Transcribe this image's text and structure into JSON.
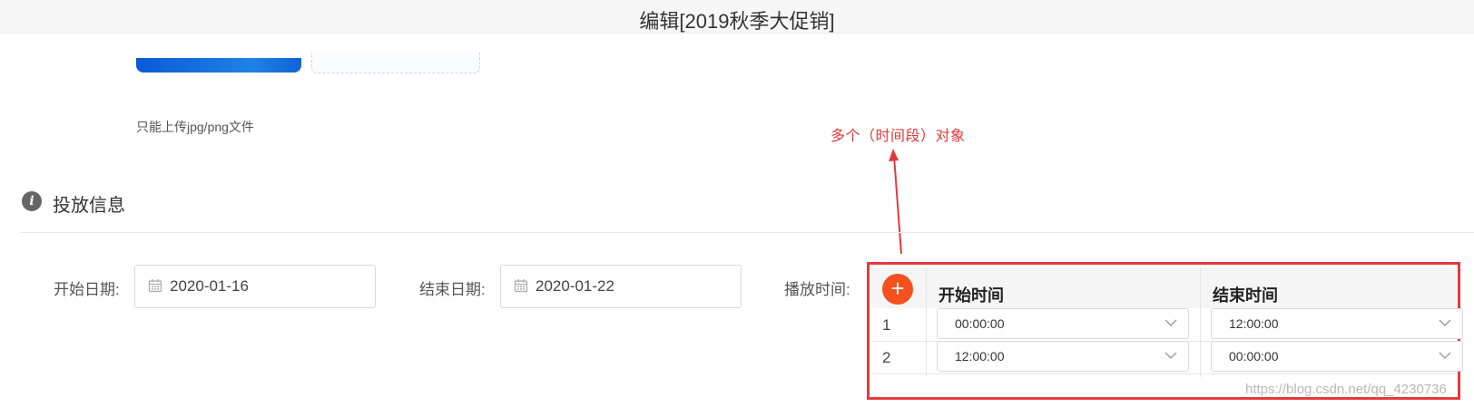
{
  "window": {
    "title": "编辑[2019秋季大促销]"
  },
  "upload": {
    "hint": "只能上传jpg/png文件"
  },
  "annotation": {
    "text": "多个（时间段）对象",
    "color": "#e4393c"
  },
  "section": {
    "title": "投放信息",
    "icon": "info-icon"
  },
  "fields": {
    "start_date": {
      "label": "开始日期:",
      "value": "2020-01-16",
      "icon": "calendar-icon"
    },
    "end_date": {
      "label": "结束日期:",
      "value": "2020-01-22",
      "icon": "calendar-icon"
    },
    "play_time": {
      "label": "播放时间:"
    }
  },
  "schedule": {
    "add_label": "+",
    "headers": {
      "start": "开始时间",
      "end": "结束时间"
    },
    "rows": [
      {
        "index": "1",
        "start": "00:00:00",
        "end": "12:00:00"
      },
      {
        "index": "2",
        "start": "12:00:00",
        "end": "00:00:00"
      }
    ]
  },
  "colors": {
    "accent": "#f4511e",
    "highlight_border": "#e4393c",
    "upload_blue": "#1673dc"
  },
  "watermark": "https://blog.csdn.net/qq_4230736"
}
